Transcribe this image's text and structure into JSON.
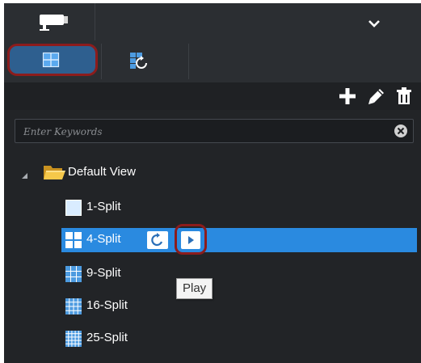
{
  "search": {
    "placeholder": "Enter Keywords",
    "value": ""
  },
  "tree": {
    "root": {
      "label": "Default View",
      "expanded": true
    },
    "items": [
      {
        "label": "1-Split",
        "grid": 1,
        "selected": false
      },
      {
        "label": "4-Split",
        "grid": 2,
        "selected": true
      },
      {
        "label": "9-Split",
        "grid": 3,
        "selected": false
      },
      {
        "label": "16-Split",
        "grid": 4,
        "selected": false
      },
      {
        "label": "25-Split",
        "grid": 5,
        "selected": false
      }
    ]
  },
  "tooltip": {
    "text": "Play"
  },
  "icons": {
    "camera": "camera-icon",
    "split": "window-split-icon",
    "sequence": "view-sequence-icon",
    "add": "plus-icon",
    "edit": "pencil-icon",
    "delete": "trash-icon",
    "clear": "clear-icon",
    "cycle": "cycle-icon",
    "play": "play-icon"
  },
  "colors": {
    "panel_bg": "#222427",
    "selected_row": "#2a8ae0",
    "active_tab": "#2e5f8f",
    "highlight_ring": "#8c1c1c"
  }
}
